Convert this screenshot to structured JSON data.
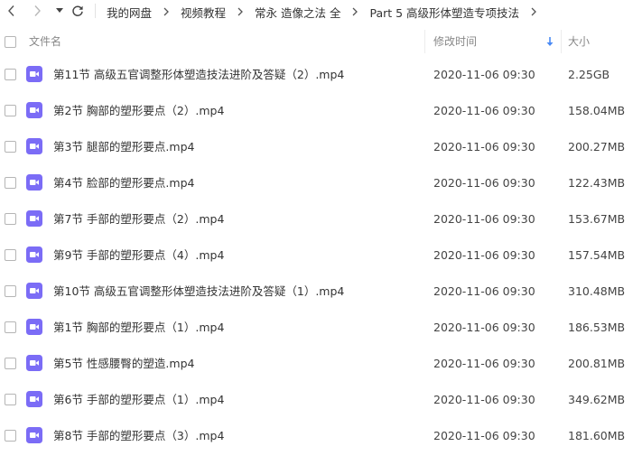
{
  "nav": {
    "back_icon": "chevron-left-icon",
    "forward_icon": "chevron-right-icon",
    "history_icon": "caret-down-icon",
    "refresh_icon": "refresh-icon"
  },
  "breadcrumb": [
    {
      "label": "我的网盘"
    },
    {
      "label": "视频教程"
    },
    {
      "label": "常永 造像之法 全"
    },
    {
      "label": "Part 5 高级形体塑造专项技法"
    }
  ],
  "columns": {
    "name": "文件名",
    "modified": "修改时间",
    "size": "大小",
    "sort_icon": "sort-down-arrow-icon"
  },
  "colors": {
    "file_icon": "#7b6cf6",
    "sort_arrow": "#4a8af4"
  },
  "files": [
    {
      "name": "第11节 高级五官调整形体塑造技法进阶及答疑（2）.mp4",
      "modified": "2020-11-06 09:30",
      "size": "2.25GB"
    },
    {
      "name": "第2节 胸部的塑形要点（2）.mp4",
      "modified": "2020-11-06 09:30",
      "size": "158.04MB"
    },
    {
      "name": "第3节 腿部的塑形要点.mp4",
      "modified": "2020-11-06 09:30",
      "size": "200.27MB"
    },
    {
      "name": "第4节 脸部的塑形要点.mp4",
      "modified": "2020-11-06 09:30",
      "size": "122.43MB"
    },
    {
      "name": "第7节 手部的塑形要点（2）.mp4",
      "modified": "2020-11-06 09:30",
      "size": "153.67MB"
    },
    {
      "name": "第9节 手部的塑形要点（4）.mp4",
      "modified": "2020-11-06 09:30",
      "size": "157.54MB"
    },
    {
      "name": "第10节 高级五官调整形体塑造技法进阶及答疑（1）.mp4",
      "modified": "2020-11-06 09:30",
      "size": "310.48MB"
    },
    {
      "name": "第1节 胸部的塑形要点（1）.mp4",
      "modified": "2020-11-06 09:30",
      "size": "186.53MB"
    },
    {
      "name": "第5节 性感腰臀的塑造.mp4",
      "modified": "2020-11-06 09:30",
      "size": "200.81MB"
    },
    {
      "name": "第6节 手部的塑形要点（1）.mp4",
      "modified": "2020-11-06 09:30",
      "size": "349.62MB"
    },
    {
      "name": "第8节 手部的塑形要点（3）.mp4",
      "modified": "2020-11-06 09:30",
      "size": "181.60MB"
    }
  ]
}
